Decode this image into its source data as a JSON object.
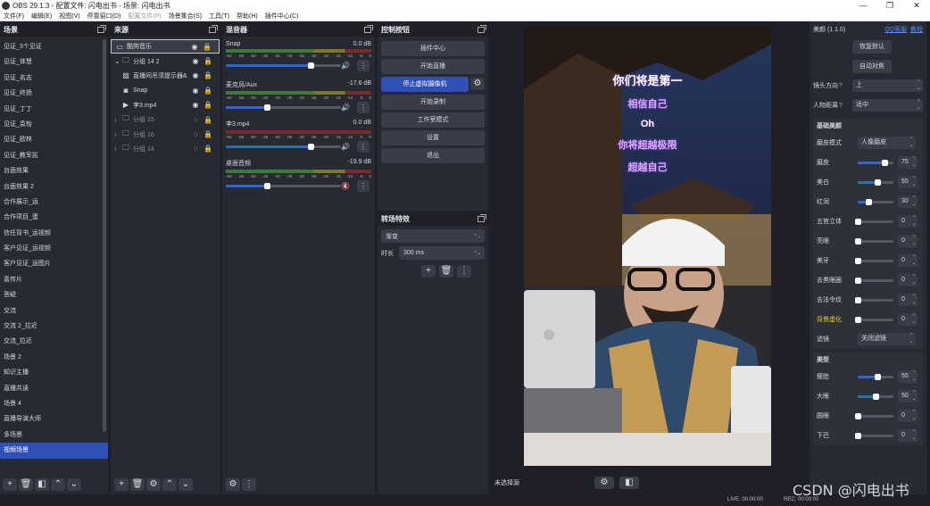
{
  "window": {
    "title": "OBS 29.1.3 - 配置文件: 闪电出书 - 场景: 闪电出书",
    "controls": [
      "—",
      "❐",
      "✕"
    ]
  },
  "menu": [
    {
      "label": "文件(F)",
      "disabled": false
    },
    {
      "label": "编辑(E)",
      "disabled": false
    },
    {
      "label": "视图(V)",
      "disabled": false
    },
    {
      "label": "停靠窗口(D)",
      "disabled": false
    },
    {
      "label": "配置文件(P)",
      "disabled": true
    },
    {
      "label": "场景集合(S)",
      "disabled": false
    },
    {
      "label": "工具(T)",
      "disabled": false
    },
    {
      "label": "帮助(H)",
      "disabled": false
    },
    {
      "label": "插件中心(C)",
      "disabled": false
    }
  ],
  "scenes": {
    "title": "场景",
    "items": [
      "见证_3个见证",
      "见证_体慧",
      "见证_名志",
      "见证_终扬",
      "见证_丁丁",
      "见证_袁怡",
      "见证_欧林",
      "见证_教军民",
      "台面效果",
      "台面效果 2",
      "合作展示_运",
      "合作项目_蛋",
      "信任背书_运视频",
      "客户见证_运视频",
      "客户见证_运图片",
      "喜传片",
      "答疑",
      "交流",
      "交流 2_拉近",
      "交流_拉近",
      "场景 2",
      "知识主播",
      "直播共读",
      "场景 4",
      "直播导演大师",
      "多场景",
      "视频场景"
    ],
    "selected_index": 26
  },
  "sources": {
    "title": "来源",
    "items": [
      {
        "label": "酷狗音乐",
        "icon": "window-icon",
        "indent": 0,
        "dim": false,
        "selected": true
      },
      {
        "label": "分组 14 2",
        "icon": "folder-icon",
        "indent": 0,
        "dim": false,
        "selected": false,
        "expanded": true
      },
      {
        "label": "直播间吊须提示器&",
        "icon": "image-icon",
        "indent": 1,
        "dim": false,
        "selected": false
      },
      {
        "label": "Snap",
        "icon": "camera-icon",
        "indent": 1,
        "dim": false,
        "selected": false
      },
      {
        "label": "李3.mp4",
        "icon": "play-icon",
        "indent": 1,
        "dim": false,
        "selected": false
      },
      {
        "label": "分组 15",
        "icon": "folder-icon",
        "indent": 0,
        "dim": true,
        "selected": false
      },
      {
        "label": "分组 16",
        "icon": "folder-icon",
        "indent": 0,
        "dim": true,
        "selected": false
      },
      {
        "label": "分组 14",
        "icon": "folder-icon",
        "indent": 0,
        "dim": true,
        "selected": false
      }
    ]
  },
  "mixer": {
    "title": "混音器",
    "ticks": [
      "-60",
      "-55",
      "-50",
      "-45",
      "-40",
      "-35",
      "-30",
      "-25",
      "-20",
      "-15",
      "-10",
      "-5",
      "0"
    ],
    "channels": [
      {
        "name": "Snap",
        "db": "0.0 dB",
        "level": 0.92,
        "muted": false
      },
      {
        "name": "麦克风/Aux",
        "db": "-17.6 dB",
        "level": 0.45,
        "muted": false
      },
      {
        "name": "李3.mp4",
        "db": "0.0 dB",
        "level": 0.92,
        "muted": false
      },
      {
        "name": "桌面音频",
        "db": "-19.9 dB",
        "level": 0.45,
        "muted": true
      }
    ]
  },
  "controls": {
    "title": "控制按钮",
    "buttons": [
      "插件中心",
      "开始直播",
      "停止虚拟摄像机",
      "开始录制",
      "工作室模式",
      "设置",
      "退出"
    ],
    "active_index": 2
  },
  "transitions": {
    "title": "转场特效",
    "type": "渐变",
    "duration_label": "时长",
    "duration": "300 ms"
  },
  "preview": {
    "status": "未选择源",
    "overlay_lines": [
      "你们将是第一",
      "相信自己",
      "Oh",
      "你将超越极限",
      "超越自己"
    ],
    "overlay_colors": [
      "#ffffff",
      "#d9a8ff",
      "#ffffff",
      "#d9a8ff",
      "#d9a8ff"
    ]
  },
  "beauty": {
    "title": "美颜 (1.1.0)",
    "links": [
      "QQ客服",
      "教程"
    ],
    "reset": "恢复默认",
    "auto": "自动对焦",
    "direction_label": "镜头方向",
    "direction": "上",
    "range_label": "人物距离",
    "range": "适中",
    "basic_title": "基础美颜",
    "mode_label": "磨皮模式",
    "mode": "人像磨皮",
    "basic": [
      {
        "label": "磨皮",
        "value": "75",
        "level": 0.75
      },
      {
        "label": "美白",
        "value": "55",
        "level": 0.55
      },
      {
        "label": "红润",
        "value": "30",
        "level": 0.3
      },
      {
        "label": "五官立体",
        "value": "0",
        "level": 0
      },
      {
        "label": "亮眼",
        "value": "0",
        "level": 0
      },
      {
        "label": "美牙",
        "value": "0",
        "level": 0
      },
      {
        "label": "去黑眼圈",
        "value": "0",
        "level": 0
      },
      {
        "label": "去法令纹",
        "value": "0",
        "level": 0
      },
      {
        "label": "背景虚化",
        "value": "0",
        "level": 0
      }
    ],
    "filter_label": "滤镜",
    "filter": "关闭滤镜",
    "shape_title": "美型",
    "shape": [
      {
        "label": "瘦脸",
        "value": "55",
        "level": 0.55
      },
      {
        "label": "大眼",
        "value": "50",
        "level": 0.5
      },
      {
        "label": "圆眼",
        "value": "0",
        "level": 0
      },
      {
        "label": "下巴",
        "value": "0",
        "level": 0
      }
    ]
  },
  "status": {
    "live": "LIVE: 00:00:00",
    "rec": "REC: 00:00:00",
    "watermark": "CSDN @闪电出书"
  }
}
